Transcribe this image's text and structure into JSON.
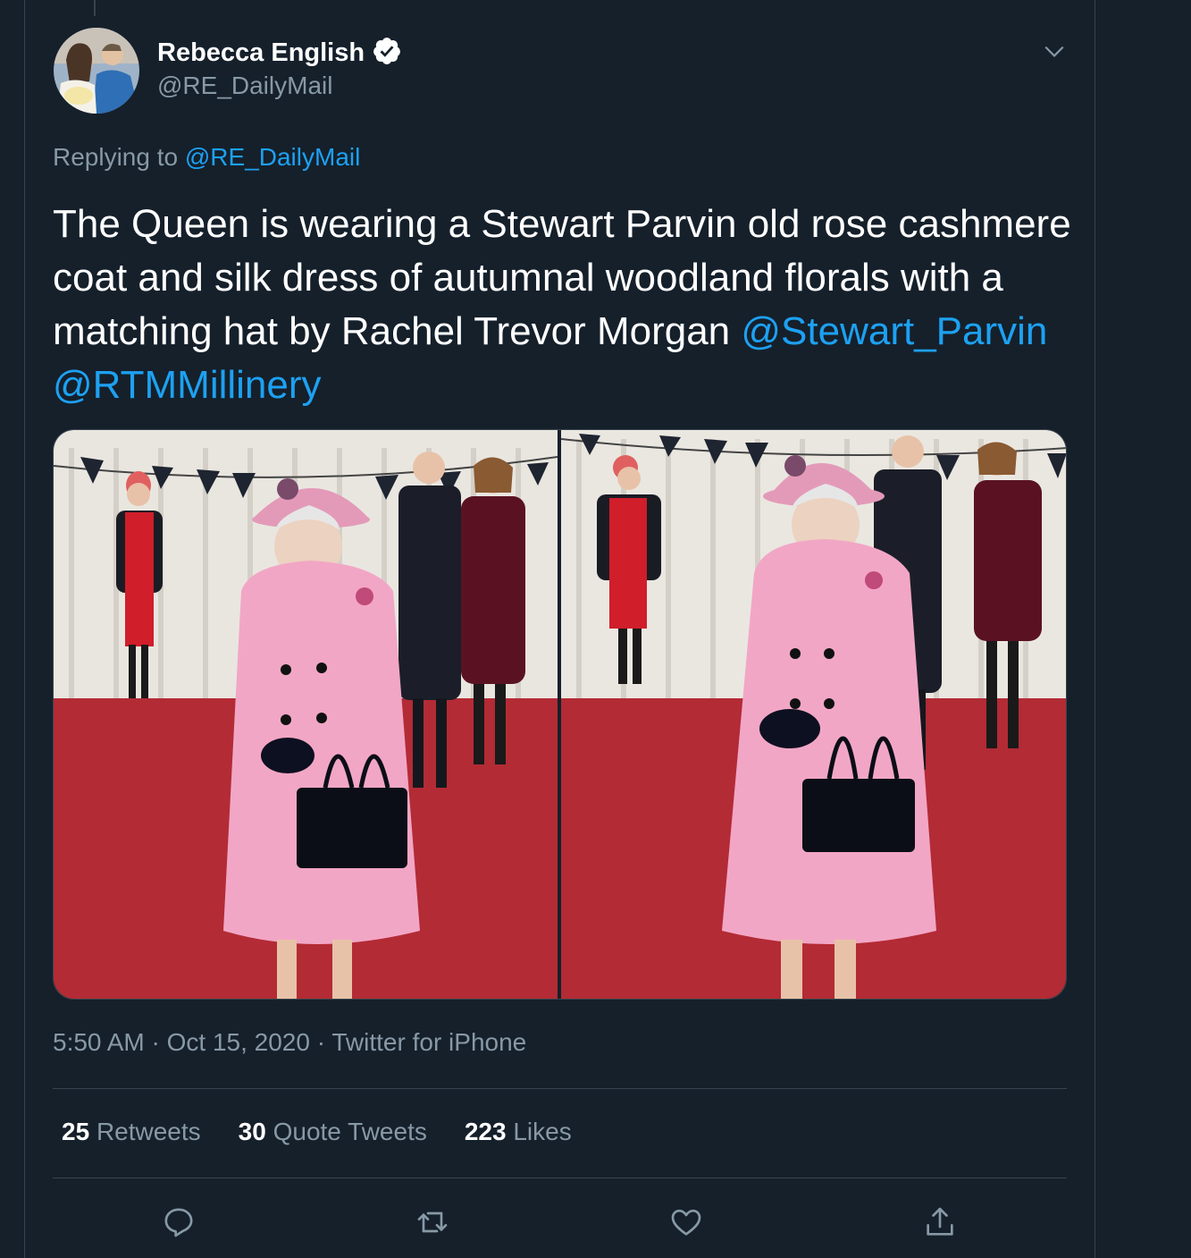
{
  "tweet": {
    "author": {
      "name": "Rebecca English",
      "handle": "@RE_DailyMail",
      "verified": true,
      "avatar_icon": "profile-photo"
    },
    "replying_prefix": "Replying to",
    "replying_to": "@RE_DailyMail",
    "text": {
      "part1": "The Queen is wearing a Stewart Parvin old rose cashmere coat and silk dress of autumnal woodland florals with a matching hat by Rachel Trevor Morgan",
      "mention1": "@Stewart_Parvin",
      "mention2": "@RTMMillinery"
    },
    "timestamp": {
      "time": "5:50 AM",
      "separator": "·",
      "date": "Oct 15, 2020",
      "source": "Twitter for iPhone"
    },
    "stats": {
      "retweets_count": "25",
      "retweets_label": "Retweets",
      "quotes_count": "30",
      "quotes_label": "Quote Tweets",
      "likes_count": "223",
      "likes_label": "Likes"
    },
    "media_count": 2
  },
  "icons": {
    "verified": "verified-badge-icon",
    "more": "chevron-down-icon",
    "reply": "reply-icon",
    "retweet": "retweet-icon",
    "like": "heart-icon",
    "share": "share-icon"
  },
  "colors": {
    "background": "#15202b",
    "border": "#38444d",
    "secondary_text": "#8899a6",
    "link": "#1da1f2"
  }
}
